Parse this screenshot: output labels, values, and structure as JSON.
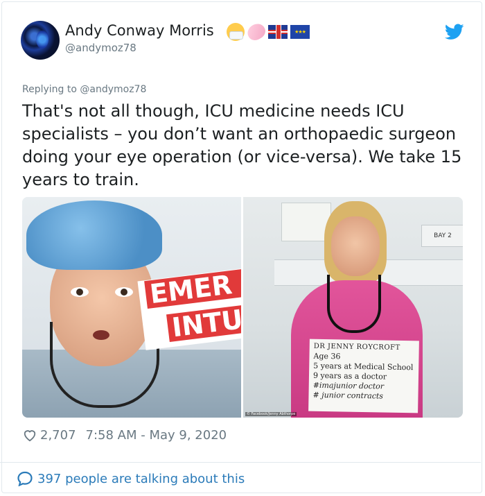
{
  "tweet": {
    "author_name": "Andy Conway Morris",
    "author_handle": "@andymoz78",
    "name_emojis": [
      "face-with-medical-mask-emoji",
      "soap-emoji",
      "uk-flag-emoji",
      "eu-flag-emoji"
    ],
    "replying_to": "Replying to @andymoz78",
    "text": "That's not all though, ICU medicine needs ICU specialists – you don’t want an orthopaedic surgeon doing your eye operation (or vice-versa).  We take 15 years to train.",
    "likes": "2,707",
    "timestamp": "7:58 AM - May 9, 2020",
    "talking_about": "397 people are talking about this"
  },
  "photo": {
    "left_banner_line1": "EMER",
    "left_banner_line2": "INTU",
    "right_bay_sign": "BAY 2",
    "sign_lines": [
      "DR JENNY ROYCROFT",
      "Age 36",
      "5 years at Medical School",
      "9 years as a doctor",
      "#imajunior doctor",
      "# junior contracts"
    ],
    "credit": "© Facebook/Jenny Abthorpe"
  },
  "colors": {
    "twitter_blue": "#1da1f2",
    "link_blue": "#2b7bb9",
    "text_primary": "#1c2022",
    "text_secondary": "#697882",
    "banner_red": "#e13a3a"
  }
}
